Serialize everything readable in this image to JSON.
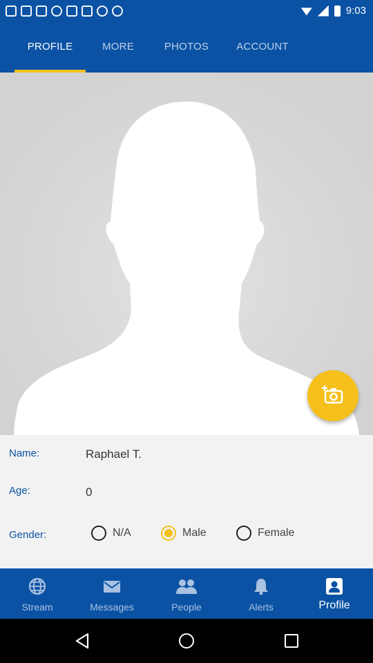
{
  "status_bar": {
    "time": "9:03"
  },
  "tabs": [
    {
      "label": "PROFILE",
      "active": true
    },
    {
      "label": "MORE",
      "active": false
    },
    {
      "label": "PHOTOS",
      "active": false
    },
    {
      "label": "ACCOUNT",
      "active": false
    }
  ],
  "profile": {
    "name_label": "Name:",
    "name_value": "Raphael T.",
    "age_label": "Age:",
    "age_value": "0",
    "gender_label": "Gender:",
    "gender_options": [
      {
        "label": "N/A",
        "selected": false
      },
      {
        "label": "Male",
        "selected": true
      },
      {
        "label": "Female",
        "selected": false
      }
    ]
  },
  "bottom_nav": [
    {
      "label": "Stream",
      "icon": "globe-icon",
      "active": false
    },
    {
      "label": "Messages",
      "icon": "envelope-icon",
      "active": false
    },
    {
      "label": "People",
      "icon": "people-icon",
      "active": false
    },
    {
      "label": "Alerts",
      "icon": "bell-icon",
      "active": false
    },
    {
      "label": "Profile",
      "icon": "profile-icon",
      "active": true
    }
  ],
  "colors": {
    "primary": "#0b52a4",
    "accent": "#f5c01c"
  }
}
